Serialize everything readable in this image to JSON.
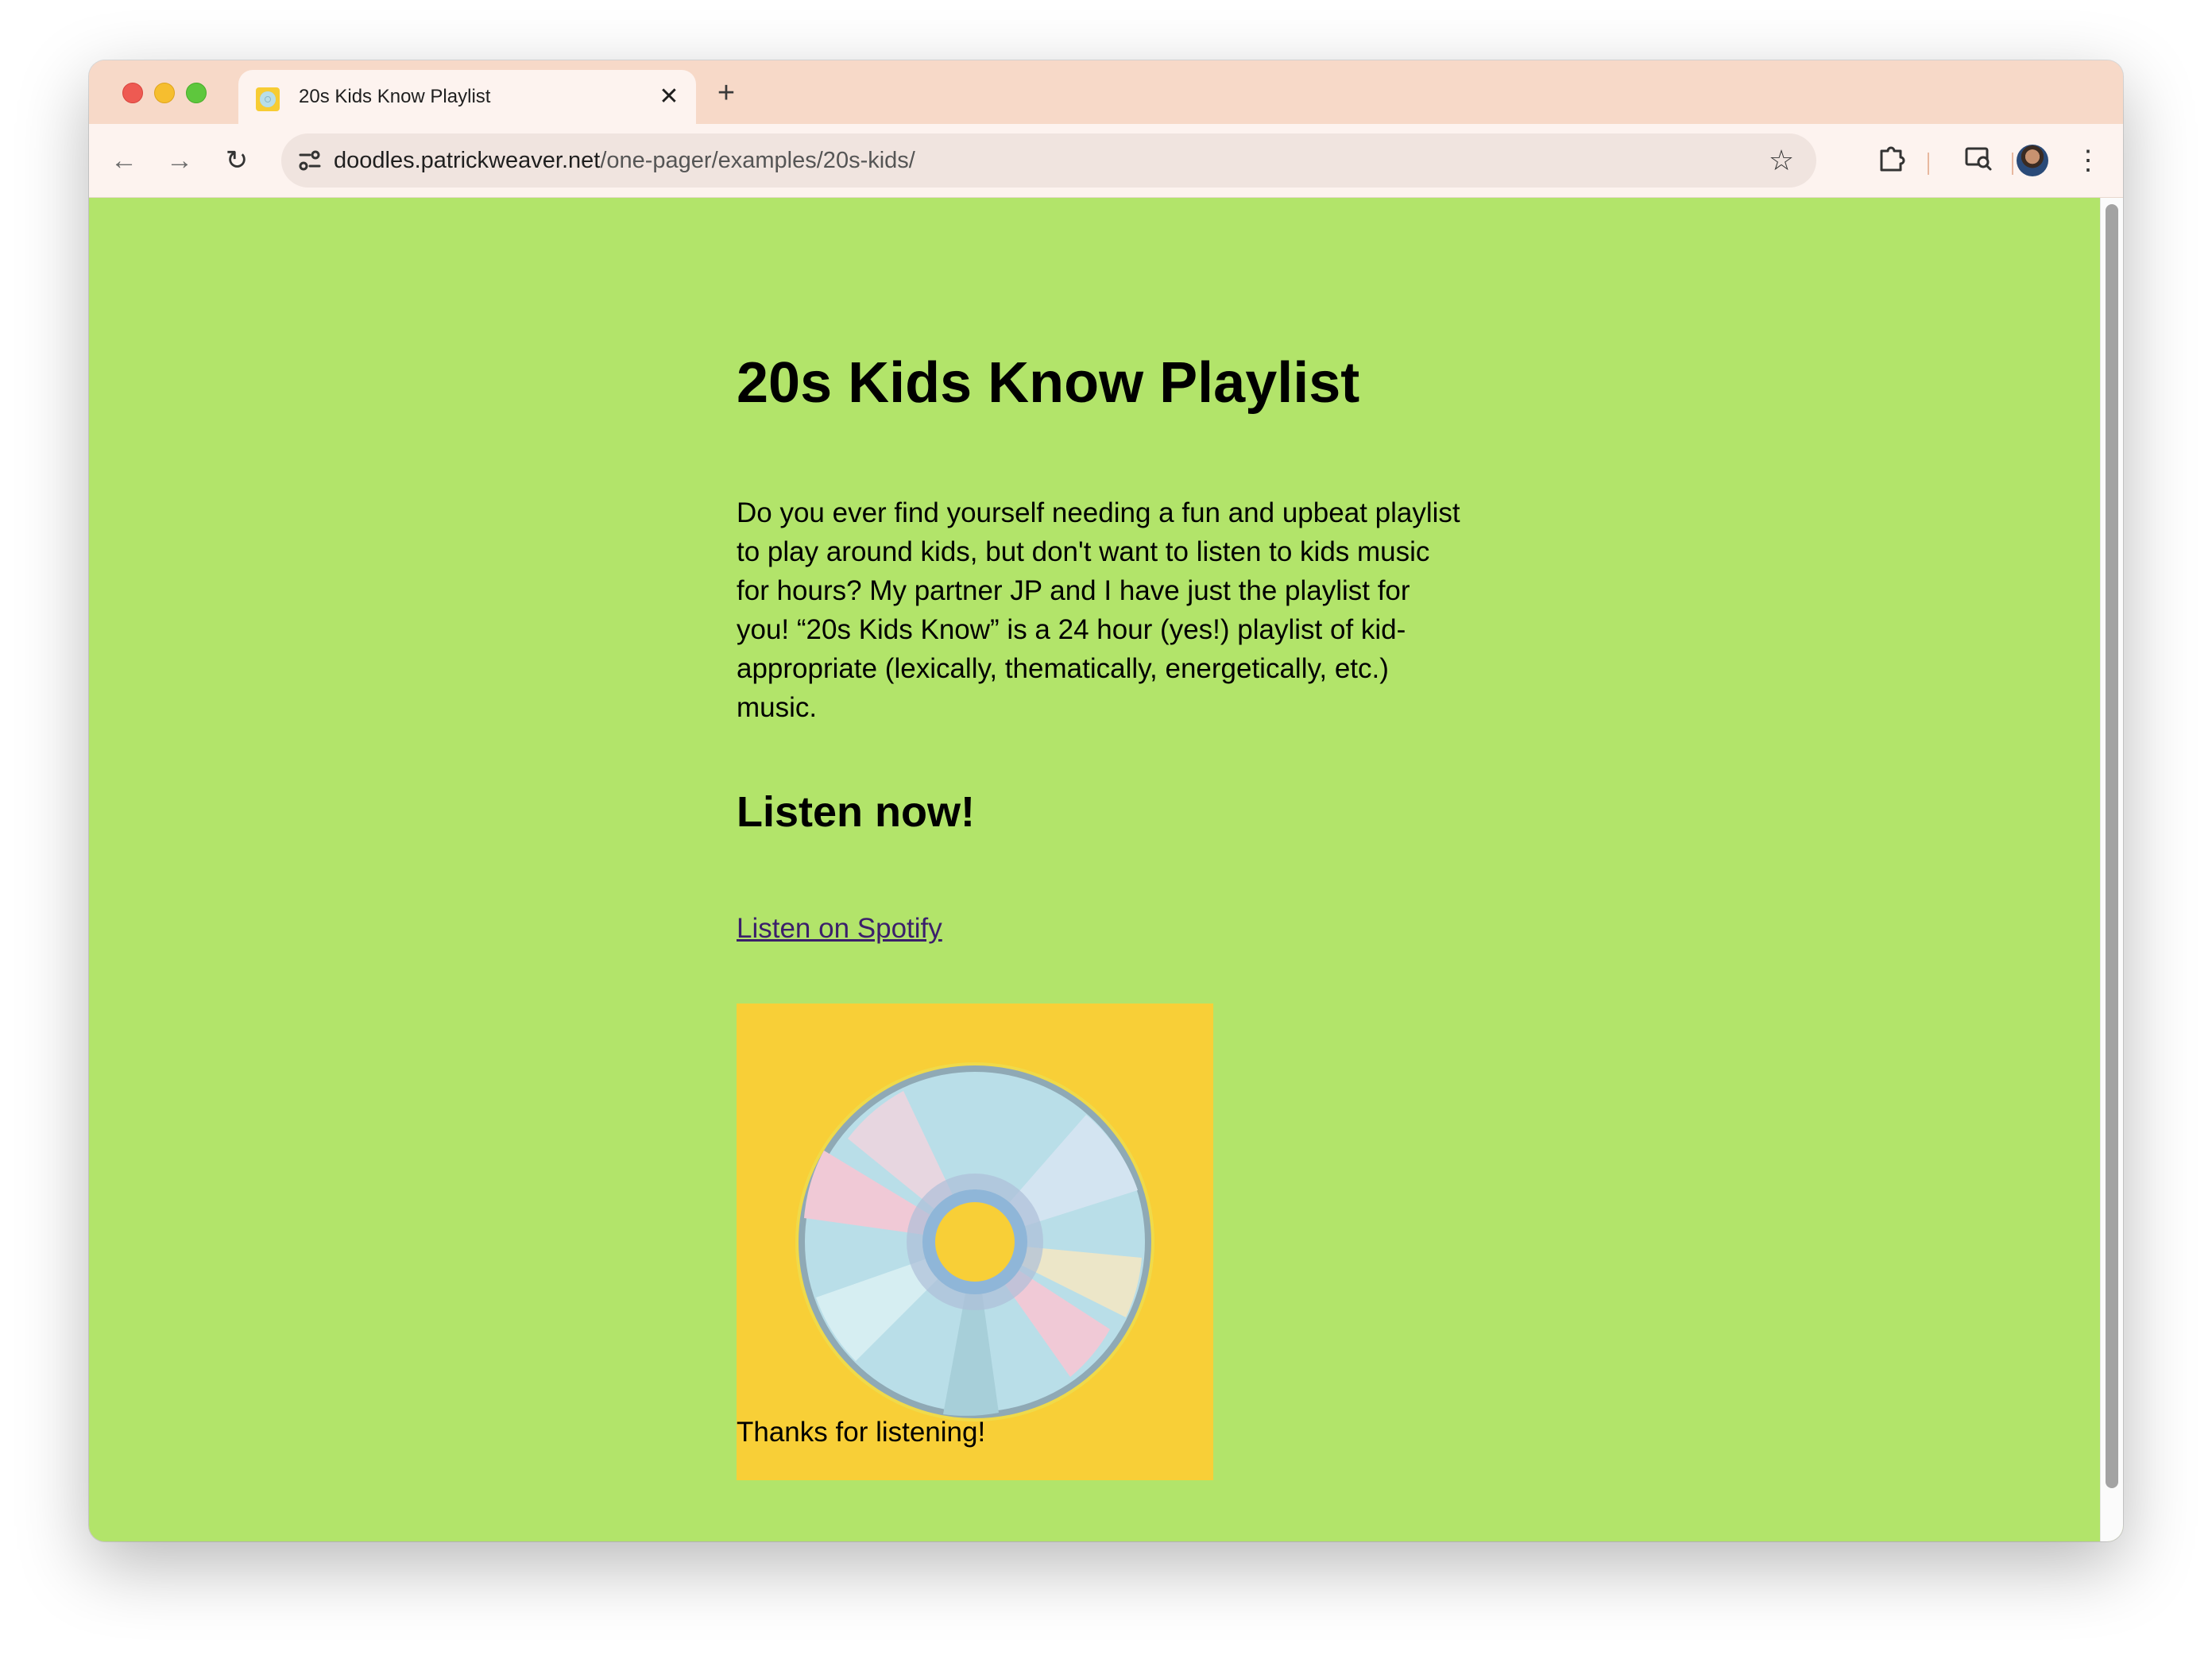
{
  "browser": {
    "tab": {
      "title": "20s Kids Know Playlist",
      "close_glyph": "✕",
      "favicon": "cd-favicon-icon"
    },
    "new_tab_glyph": "+",
    "url": {
      "host": "doodles.patrickweaver.net",
      "path": "/one-pager/examples/20s-kids/"
    },
    "icons": {
      "back": "←",
      "forward": "→",
      "reload": "↻",
      "star": "☆",
      "menu": "⋮"
    }
  },
  "page": {
    "title": "20s Kids Know Playlist",
    "intro": "Do you ever find yourself needing a fun and upbeat playlist to play around kids, but don't want to listen to kids music for hours? My partner JP and I have just the playlist for you! “20s Kids Know” is a 24 hour (yes!) playlist of kid-appropriate (lexically, thematically, energetically, etc.) music.",
    "listen_heading": "Listen now!",
    "spotify_link": "Listen on Spotify",
    "thanks": "Thanks for listening!"
  },
  "colors": {
    "page_background": "#b2e46a",
    "cover_background": "#f8cf37",
    "disc_light": "#b9dee8",
    "link": "#3b1f6b",
    "tab_strip": "#f7d9c8"
  }
}
